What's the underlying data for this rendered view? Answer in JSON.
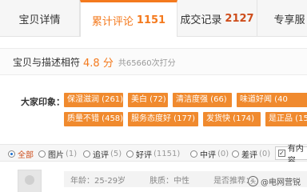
{
  "tabs": [
    {
      "label": "宝贝详情",
      "count": ""
    },
    {
      "label": "累计评论",
      "count": "1151"
    },
    {
      "label": "成交记录",
      "count": "2127"
    },
    {
      "label": "专享服",
      "count": ""
    }
  ],
  "rating": {
    "label": "宝贝与描述相符",
    "score": "4.8 分",
    "sub": "共65660次打分"
  },
  "impressions": {
    "label": "大家印象：",
    "tags": [
      "保湿滋润 (261)",
      "美白 (72)",
      "清洁度强 (66)",
      "味道好闻 (40",
      "质量不错 (458)",
      "服务态度好 (177)",
      "发货快 (174)",
      "是正品 (15"
    ]
  },
  "filter": {
    "options": [
      {
        "label": "全部",
        "count": ""
      },
      {
        "label": "图片",
        "count": "(1)"
      },
      {
        "label": "追评",
        "count": "(5)"
      },
      {
        "label": "好评",
        "count": "(1151)"
      },
      {
        "label": "中评",
        "count": "(0)"
      },
      {
        "label": "差评",
        "count": "(0)"
      }
    ],
    "has_content_label": "有内容",
    "has_content_checked": true
  },
  "review": {
    "age": "年龄：25-29岁",
    "skin": "肤质：中性",
    "recommend": "是否推荐："
  },
  "watermark": {
    "text": "@电网营锐"
  },
  "colors": {
    "accent": "#f47a1e",
    "tag_bg": "#f08a2e",
    "count_red": "#ce4d1b"
  }
}
